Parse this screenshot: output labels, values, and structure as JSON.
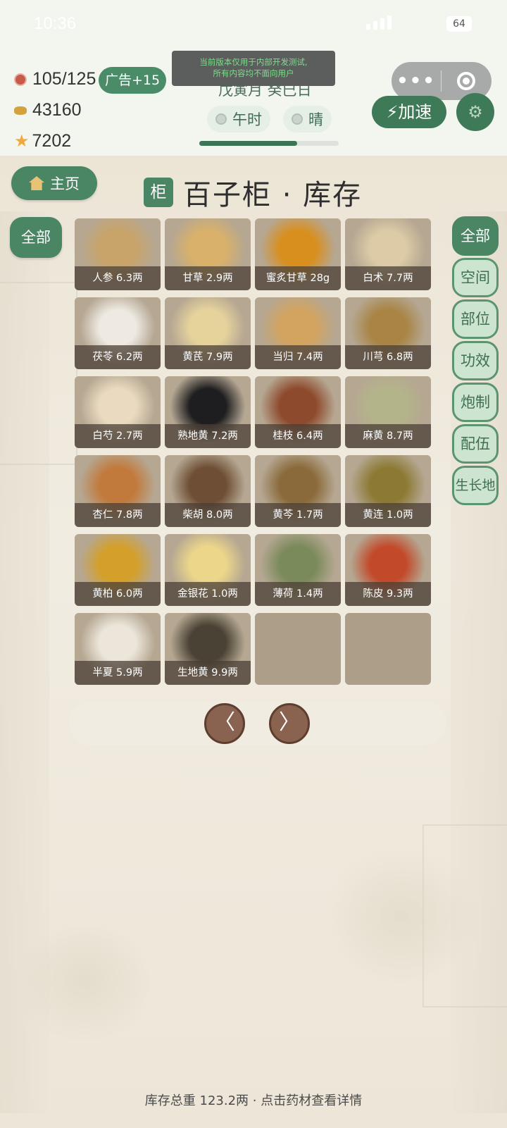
{
  "status_bar": {
    "time": "10:36",
    "battery": "64"
  },
  "resources": {
    "stamina": "105/125",
    "ad_button": "广告+15",
    "coins": "43160",
    "stars": "7202"
  },
  "dev_notice": {
    "line1": "当前版本仅用于内部开发测试,",
    "line2": "所有内容均不面向用户"
  },
  "calendar": {
    "date": "戊寅月 癸巳日",
    "hour": "午时",
    "weather": "晴",
    "progress_fraction": 0.7
  },
  "capsule": {
    "more": "•••"
  },
  "speed_button": "⚡加速",
  "home_button": "主页",
  "title": {
    "badge": "柜",
    "text": "百子柜 · 库存"
  },
  "left_filter": "全部",
  "right_filters": [
    "全部",
    "空间",
    "部位",
    "功效",
    "炮制",
    "配伍",
    "生长地"
  ],
  "items": [
    {
      "name": "人参",
      "amount": "6.3两",
      "label": "人参 6.3两",
      "color": "#c9a46a"
    },
    {
      "name": "甘草",
      "amount": "2.9两",
      "label": "甘草 2.9两",
      "color": "#d9b16a"
    },
    {
      "name": "蜜炙甘草",
      "amount": "28g",
      "label": "蜜炙甘草 28g",
      "color": "#d98f1e"
    },
    {
      "name": "白术",
      "amount": "7.7两",
      "label": "白术 7.7两",
      "color": "#dccba6"
    },
    {
      "name": "茯苓",
      "amount": "6.2两",
      "label": "茯苓 6.2两",
      "color": "#eeeae2"
    },
    {
      "name": "黄芪",
      "amount": "7.9两",
      "label": "黄芪 7.9两",
      "color": "#e6d39c"
    },
    {
      "name": "当归",
      "amount": "7.4两",
      "label": "当归 7.4两",
      "color": "#d2a460"
    },
    {
      "name": "川芎",
      "amount": "6.8两",
      "label": "川芎 6.8两",
      "color": "#a98444"
    },
    {
      "name": "白芍",
      "amount": "2.7两",
      "label": "白芍 2.7两",
      "color": "#eadbc0"
    },
    {
      "name": "熟地黄",
      "amount": "7.2两",
      "label": "熟地黄 7.2两",
      "color": "#1e1e20"
    },
    {
      "name": "桂枝",
      "amount": "6.4两",
      "label": "桂枝 6.4两",
      "color": "#8e4a2c"
    },
    {
      "name": "麻黄",
      "amount": "8.7两",
      "label": "麻黄 8.7两",
      "color": "#b4b48a"
    },
    {
      "name": "杏仁",
      "amount": "7.8两",
      "label": "杏仁 7.8两",
      "color": "#c27a3c"
    },
    {
      "name": "柴胡",
      "amount": "8.0两",
      "label": "柴胡 8.0两",
      "color": "#6e4e34"
    },
    {
      "name": "黄芩",
      "amount": "1.7两",
      "label": "黄芩 1.7两",
      "color": "#8a6a3a"
    },
    {
      "name": "黄连",
      "amount": "1.0两",
      "label": "黄连 1.0两",
      "color": "#8c7a34"
    },
    {
      "name": "黄柏",
      "amount": "6.0两",
      "label": "黄柏 6.0两",
      "color": "#d4a02a"
    },
    {
      "name": "金银花",
      "amount": "1.0两",
      "label": "金银花 1.0两",
      "color": "#ecd68a"
    },
    {
      "name": "薄荷",
      "amount": "1.4两",
      "label": "薄荷 1.4两",
      "color": "#7a8a5a"
    },
    {
      "name": "陈皮",
      "amount": "9.3两",
      "label": "陈皮 9.3两",
      "color": "#c24a2a"
    },
    {
      "name": "半夏",
      "amount": "5.9两",
      "label": "半夏 5.9两",
      "color": "#ece6da"
    },
    {
      "name": "生地黄",
      "amount": "9.9两",
      "label": "生地黄 9.9两",
      "color": "#4a4234"
    }
  ],
  "empty_slots": 2,
  "pager": {
    "prev": "〈",
    "next": "〉"
  },
  "footer": "库存总重 123.2两 · 点击药材查看详情",
  "colors": {
    "primary_green": "#4a8564",
    "brown_button": "#8a6350"
  }
}
